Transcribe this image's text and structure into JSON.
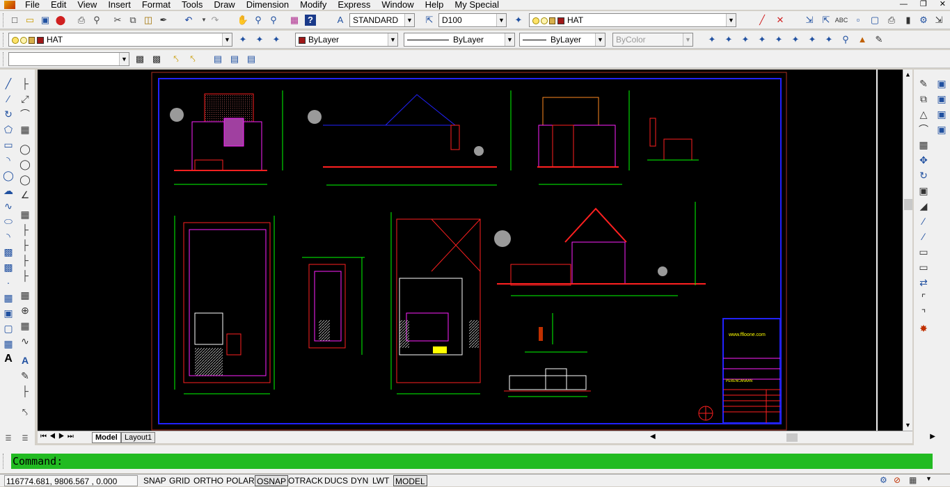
{
  "menu": [
    "File",
    "Edit",
    "View",
    "Insert",
    "Format",
    "Tools",
    "Draw",
    "Dimension",
    "Modify",
    "Express",
    "Window",
    "Help",
    "My Special"
  ],
  "toolbar1": {
    "text_style": "STANDARD",
    "dim_style": "D100",
    "layer": "HAT"
  },
  "toolbar2": {
    "layer": "HAT",
    "color": "ByLayer",
    "linetype": "ByLayer",
    "lineweight": "ByLayer",
    "plotstyle": "ByColor"
  },
  "toolbar3": {
    "ucs_combo": ""
  },
  "tabs": [
    "Model",
    "Layout1"
  ],
  "active_tab": "Model",
  "command": {
    "prompt": "Command:"
  },
  "status": {
    "coordinates": "116774.681, 9806.567 , 0.000",
    "buttons": [
      "SNAP",
      "GRID",
      "ORTHO",
      "POLAR",
      "OSNAP",
      "OTRACK",
      "DUCS",
      "DYN",
      "LWT",
      "MODEL"
    ],
    "active": [
      "OSNAP",
      "MODEL"
    ]
  },
  "drawing": {
    "title_block_site": "www.ffloone.com",
    "title_block_project": "PERENCANAAN"
  },
  "colors": {
    "cad_background": "#000000",
    "command_bar": "#22bb22",
    "frame": "#2222ff",
    "dimension": "#00ff00",
    "red": "#ff2020",
    "magenta": "#ff22ff",
    "yellow": "#ffff00"
  }
}
